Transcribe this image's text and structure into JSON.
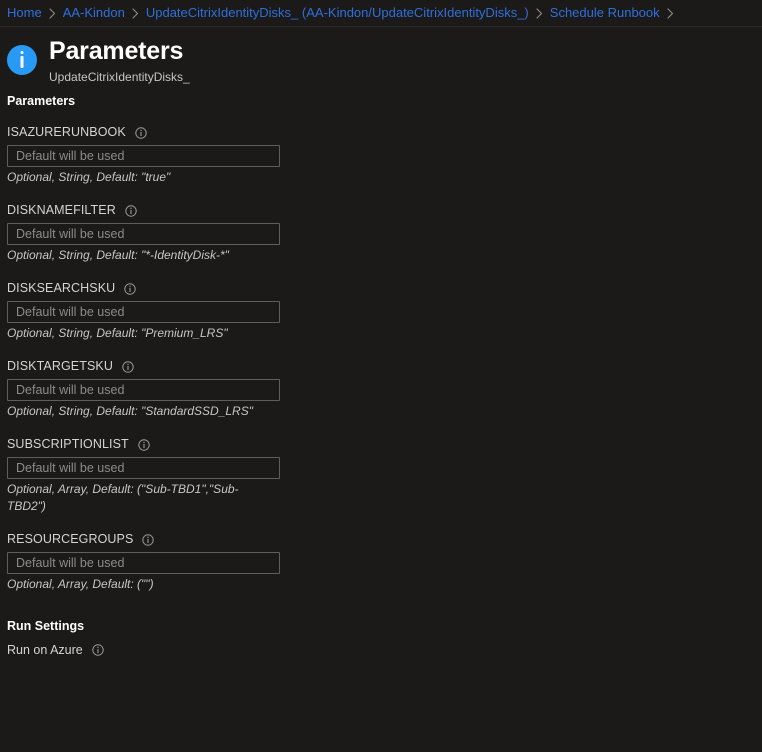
{
  "breadcrumb": {
    "items": [
      {
        "label": "Home"
      },
      {
        "label": "AA-Kindon"
      },
      {
        "label": "UpdateCitrixIdentityDisks_ (AA-Kindon/UpdateCitrixIdentityDisks_)"
      },
      {
        "label": "Schedule Runbook"
      }
    ]
  },
  "header": {
    "icon": "info-circle-icon",
    "title": "Parameters",
    "subtitle": "UpdateCitrixIdentityDisks_"
  },
  "parameters_section": {
    "heading": "Parameters",
    "fields": [
      {
        "label": "ISAZURERUNBOOK",
        "value": "",
        "placeholder": "Default will be used",
        "hint": "Optional, String, Default: \"true\""
      },
      {
        "label": "DISKNAMEFILTER",
        "value": "",
        "placeholder": "Default will be used",
        "hint": "Optional, String, Default: \"*-IdentityDisk-*\""
      },
      {
        "label": "DISKSEARCHSKU",
        "value": "",
        "placeholder": "Default will be used",
        "hint": "Optional, String, Default: \"Premium_LRS\""
      },
      {
        "label": "DISKTARGETSKU",
        "value": "",
        "placeholder": "Default will be used",
        "hint": "Optional, String, Default: \"StandardSSD_LRS\""
      },
      {
        "label": "SUBSCRIPTIONLIST",
        "value": "",
        "placeholder": "Default will be used",
        "hint": "Optional, Array, Default: (\"Sub-TBD1\",\"Sub-TBD2\")"
      },
      {
        "label": "RESOURCEGROUPS",
        "value": "",
        "placeholder": "Default will be used",
        "hint": "Optional, Array, Default: (\"\")"
      }
    ]
  },
  "run_settings_section": {
    "heading": "Run Settings",
    "run_on_label": "Run on Azure"
  },
  "colors": {
    "background": "#1b1a19",
    "link": "#2f6fdb",
    "accent": "#2899f5",
    "text": "#ffffff",
    "muted_text": "#c8c6c4",
    "input_border": "#605e5c"
  }
}
